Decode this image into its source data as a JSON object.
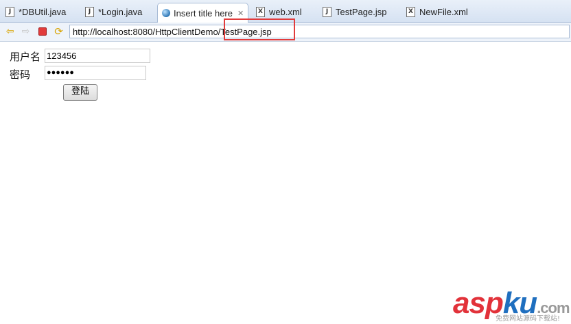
{
  "tabs": [
    {
      "label": "*DBUtil.java",
      "icon": "java-file-icon"
    },
    {
      "label": "*Login.java",
      "icon": "java-file-icon"
    },
    {
      "label": "Insert title here",
      "icon": "globe-icon",
      "active": true
    },
    {
      "label": "web.xml",
      "icon": "xml-file-icon"
    },
    {
      "label": "TestPage.jsp",
      "icon": "jsp-file-icon"
    },
    {
      "label": "NewFile.xml",
      "icon": "xml-file-icon"
    }
  ],
  "toolbar": {
    "url": "http://localhost:8080/HttpClientDemo/TestPage.jsp"
  },
  "form": {
    "username_label": "用户名",
    "username_value": "123456",
    "password_label": "密码",
    "password_value": "●●●●●●",
    "login_label": "登陆"
  },
  "watermark": {
    "brand_left": "asp",
    "brand_right": "ku",
    "brand_suffix": ".com",
    "subtitle": "免费网站源码下载站!"
  },
  "colors": {
    "highlight": "#e23b3b",
    "watermark_red": "#e2323a",
    "watermark_blue": "#1f6fbf"
  }
}
